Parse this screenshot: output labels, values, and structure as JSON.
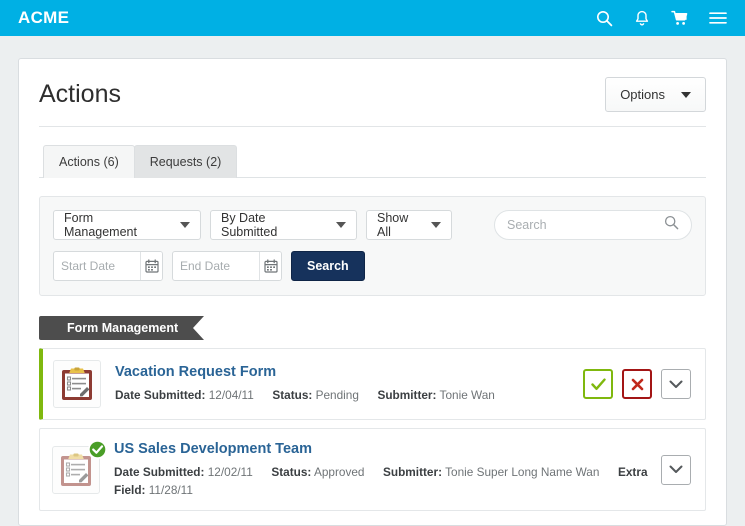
{
  "header": {
    "brand": "ACME",
    "icons": [
      {
        "name": "search-icon",
        "label": "Search"
      },
      {
        "name": "bell-icon",
        "label": "Notifications"
      },
      {
        "name": "cart-icon",
        "label": "Cart"
      },
      {
        "name": "hamburger-menu-icon",
        "label": "Menu"
      }
    ],
    "background_color": "#00b0e4"
  },
  "page": {
    "title": "Actions",
    "options_button": "Options"
  },
  "tabs": [
    {
      "label": "Actions (6)",
      "active": true
    },
    {
      "label": "Requests (2)",
      "active": false
    }
  ],
  "filters": {
    "category_select": "Form Management",
    "sort_select": "By Date Submitted",
    "show_select": "Show All",
    "search_placeholder": "Search",
    "search_value": "",
    "start_date_placeholder": "Start Date",
    "start_date_value": "",
    "end_date_placeholder": "End Date",
    "end_date_value": "",
    "search_button": "Search",
    "search_button_color": "#16325c"
  },
  "section": {
    "ribbon_label": "Form Management",
    "ribbon_color": "#4d4d4d"
  },
  "list": {
    "accent_color": "#7fb80e",
    "items": [
      {
        "title": "Vacation Request Form",
        "date_label": "Date Submitted:",
        "date_value": "12/04/11",
        "status_label": "Status:",
        "status_value": "Pending",
        "submitter_label": "Submitter:",
        "submitter_value": "Tonie Wan",
        "extra_label": "",
        "extra_value": "",
        "has_accent": true,
        "has_check_badge": false,
        "actions": [
          "approve-check",
          "reject-x",
          "expand-chevron"
        ]
      },
      {
        "title": "US Sales Development Team",
        "date_label": "Date Submitted:",
        "date_value": "12/02/11",
        "status_label": "Status:",
        "status_value": "Approved",
        "submitter_label": "Submitter:",
        "submitter_value": "Tonie Super Long Name Wan",
        "extra_label": "Extra Field:",
        "extra_value": "11/28/11",
        "has_accent": false,
        "has_check_badge": true,
        "actions": [
          "expand-chevron"
        ]
      }
    ]
  }
}
